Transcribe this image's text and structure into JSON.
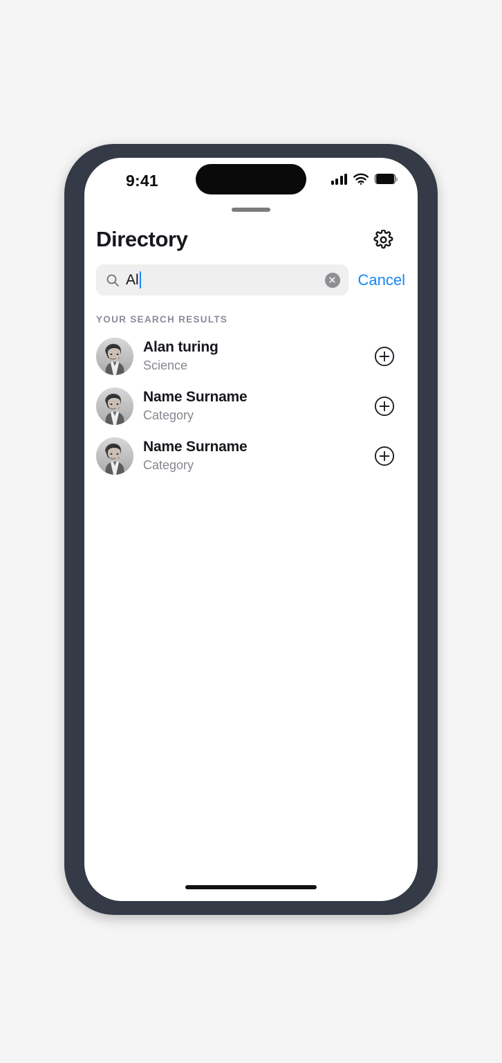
{
  "device": {
    "status_bar": {
      "time": "9:41",
      "cellular_icon": "signal-bars-icon",
      "wifi_icon": "wifi-icon",
      "battery_icon": "battery-icon"
    },
    "dynamic_island": "dynamic-island",
    "home_indicator": "home-indicator",
    "grabber": "sheet-grabber"
  },
  "colors": {
    "page_background": "#f5f5f5",
    "frame": "#343a46",
    "screen": "#ffffff",
    "accent_blue": "#1787f5",
    "search_field": "#efefef",
    "section_label": "#8b8b99",
    "secondary_text": "#86868f",
    "primary_text": "#16181d",
    "clear_button": "#8e8e93"
  },
  "header": {
    "title": "Directory",
    "settings_icon": "gear-icon",
    "settings_label": "Settings"
  },
  "search": {
    "icon": "search-icon",
    "value": "Al",
    "placeholder": "Search",
    "clear_icon": "close-circle-icon",
    "cancel_label": "Cancel"
  },
  "results": {
    "section_label": "Your search results",
    "items": [
      {
        "name": "Alan turing",
        "category": "Science",
        "avatar": "portrait-avatar",
        "action_icon": "plus-circle-icon"
      },
      {
        "name": "Name Surname",
        "category": "Category",
        "avatar": "portrait-avatar",
        "action_icon": "plus-circle-icon"
      },
      {
        "name": "Name Surname",
        "category": "Category",
        "avatar": "portrait-avatar",
        "action_icon": "plus-circle-icon"
      }
    ]
  }
}
